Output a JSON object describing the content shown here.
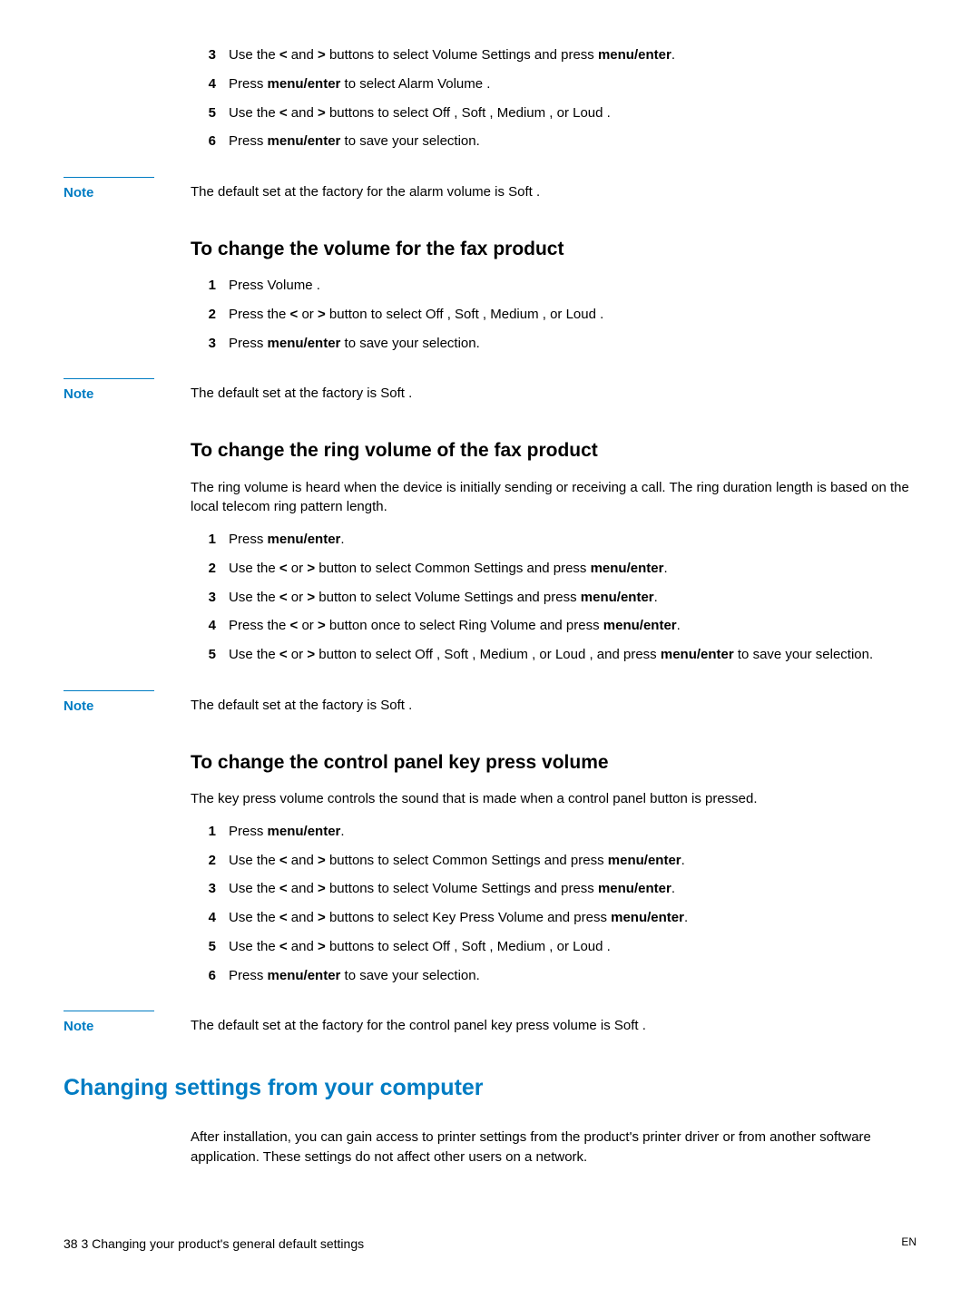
{
  "top_list": [
    {
      "n": "3",
      "parts": [
        "Use the ",
        "<",
        " and ",
        ">",
        " buttons to select Volume Settings    and press ",
        "menu/enter",
        "."
      ]
    },
    {
      "n": "4",
      "parts": [
        "Press ",
        "menu/enter",
        " to select Alarm Volume  ."
      ]
    },
    {
      "n": "5",
      "parts": [
        "Use the ",
        "<",
        " and ",
        ">",
        " buttons to select Off , Soft  , Medium , or Loud ."
      ]
    },
    {
      "n": "6",
      "parts": [
        "Press ",
        "menu/enter",
        " to save your selection."
      ]
    }
  ],
  "note1_label": "Note",
  "note1_text": "The default set at the factory for the alarm volume is Soft  .",
  "h_fax": "To change the volume for the fax product",
  "fax_list": [
    {
      "n": "1",
      "parts": [
        "Press Volume ."
      ]
    },
    {
      "n": "2",
      "parts": [
        "Press the ",
        "<",
        " or ",
        ">",
        " button to select Off , Soft  , Medium , or Loud ."
      ]
    },
    {
      "n": "3",
      "parts": [
        "Press ",
        "menu/enter",
        " to save your selection."
      ]
    }
  ],
  "note2_label": "Note",
  "note2_text": "The default set at the factory is Soft  .",
  "h_ring": "To change the ring volume of the fax product",
  "ring_intro": "The ring volume is heard when the device is initially sending or receiving a call. The ring duration length is based on the local telecom ring pattern length.",
  "ring_list": [
    {
      "n": "1",
      "parts": [
        "Press ",
        "menu/enter",
        "."
      ]
    },
    {
      "n": "2",
      "parts": [
        "Use the ",
        "<",
        " or ",
        ">",
        " button to select Common Settings    and press ",
        "menu/enter",
        "."
      ]
    },
    {
      "n": "3",
      "parts": [
        "Use the ",
        "<",
        " or ",
        ">",
        " button to select Volume Settings    and press ",
        "menu/enter",
        "."
      ]
    },
    {
      "n": "4",
      "parts": [
        "Press the ",
        "<",
        " or ",
        ">",
        " button once to select Ring Volume   and press ",
        "menu/enter",
        "."
      ]
    },
    {
      "n": "5",
      "parts": [
        "Use the ",
        "<",
        " or ",
        ">",
        " button to select Off , Soft  , Medium , or Loud , and press ",
        "menu/enter",
        " to save your selection."
      ]
    }
  ],
  "note3_label": "Note",
  "note3_text": "The default set at the factory is Soft  .",
  "h_key": "To change the control panel key press volume",
  "key_intro": "The key press volume controls the sound that is made when a control panel button is pressed.",
  "key_list": [
    {
      "n": "1",
      "parts": [
        "Press ",
        "menu/enter",
        "."
      ]
    },
    {
      "n": "2",
      "parts": [
        "Use the ",
        "<",
        " and ",
        ">",
        " buttons to select Common Settings    and press ",
        "menu/enter",
        "."
      ]
    },
    {
      "n": "3",
      "parts": [
        "Use the ",
        "<",
        " and ",
        ">",
        " buttons to select Volume Settings    and press ",
        "menu/enter",
        "."
      ]
    },
    {
      "n": "4",
      "parts": [
        "Use the ",
        "<",
        " and ",
        ">",
        " buttons to select Key Press Volume    and press ",
        "menu/enter",
        "."
      ]
    },
    {
      "n": "5",
      "parts": [
        "Use the ",
        "<",
        " and ",
        ">",
        " buttons to select Off , Soft  , Medium , or Loud ."
      ]
    },
    {
      "n": "6",
      "parts": [
        "Press ",
        "menu/enter",
        " to save your selection."
      ]
    }
  ],
  "note4_label": "Note",
  "note4_text": "The default set at the factory for the control panel key press volume is Soft  .",
  "h_section": "Changing settings from your computer",
  "section_intro": "After installation, you can gain access to printer settings from the product's printer driver or from another software application. These settings do not affect other users on a network.",
  "footer_left": "38   3 Changing your product's general default settings",
  "footer_right": "EN",
  "bold_tokens": [
    "<",
    ">",
    "menu/enter"
  ]
}
